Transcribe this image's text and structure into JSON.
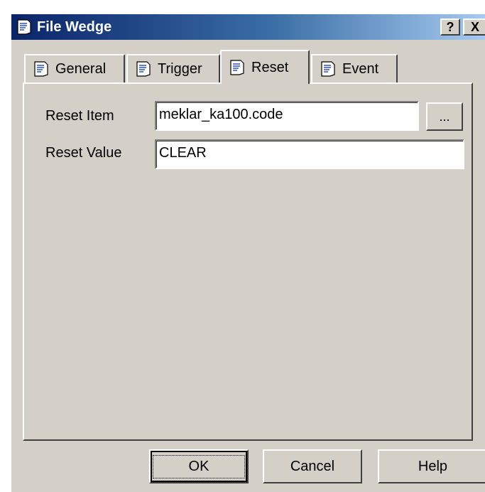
{
  "window": {
    "title": "File Wedge",
    "help_label": "?",
    "close_label": "X"
  },
  "tabs": [
    {
      "label": "General"
    },
    {
      "label": "Trigger"
    },
    {
      "label": "Reset",
      "selected": true
    },
    {
      "label": "Event"
    }
  ],
  "reset": {
    "item_label": "Reset Item",
    "item_value": "meklar_ka100.code",
    "browse_label": "...",
    "value_label": "Reset Value",
    "value_value": "CLEAR"
  },
  "buttons": {
    "ok": "OK",
    "cancel": "Cancel",
    "help": "Help"
  },
  "colors": {
    "dialog_bg": "#d4d0c8",
    "titlebar_start": "#0a246a",
    "titlebar_end": "#a6caf0"
  },
  "icons": {
    "title": "document-icon",
    "tab": "document-icon"
  }
}
